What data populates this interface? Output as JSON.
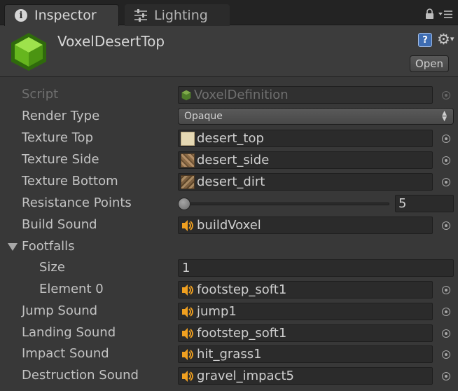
{
  "tabs": [
    {
      "label": "Inspector",
      "icon": "info-icon",
      "active": true
    },
    {
      "label": "Lighting",
      "icon": "lighting-sliders-icon",
      "active": false
    }
  ],
  "header": {
    "object_name": "VoxelDesertTop",
    "open_label": "Open",
    "icon": "voxel-cube-icon",
    "help_glyph": "?"
  },
  "properties": {
    "script": {
      "label": "Script",
      "value": "VoxelDefinition"
    },
    "render_type": {
      "label": "Render Type",
      "value": "Opaque"
    },
    "texture_top": {
      "label": "Texture Top",
      "value": "desert_top"
    },
    "texture_side": {
      "label": "Texture Side",
      "value": "desert_side"
    },
    "texture_bottom": {
      "label": "Texture Bottom",
      "value": "desert_dirt"
    },
    "resistance_points": {
      "label": "Resistance Points",
      "value": "5",
      "slider_fraction": 0.0
    },
    "build_sound": {
      "label": "Build Sound",
      "value": "buildVoxel"
    },
    "footfalls": {
      "label": "Footfalls",
      "size_label": "Size",
      "size_value": "1",
      "elements": [
        {
          "label": "Element 0",
          "value": "footstep_soft1"
        }
      ]
    },
    "jump_sound": {
      "label": "Jump Sound",
      "value": "jump1"
    },
    "landing_sound": {
      "label": "Landing Sound",
      "value": "footstep_soft1"
    },
    "impact_sound": {
      "label": "Impact Sound",
      "value": "hit_grass1"
    },
    "destruction_sound": {
      "label": "Destruction Sound",
      "value": "gravel_impact5"
    }
  },
  "colors": {
    "background": "#383838",
    "tabbar": "#232323",
    "field": "#2b2b2b",
    "voxel_green": "#6cc424",
    "audio_orange": "#f0a020"
  }
}
